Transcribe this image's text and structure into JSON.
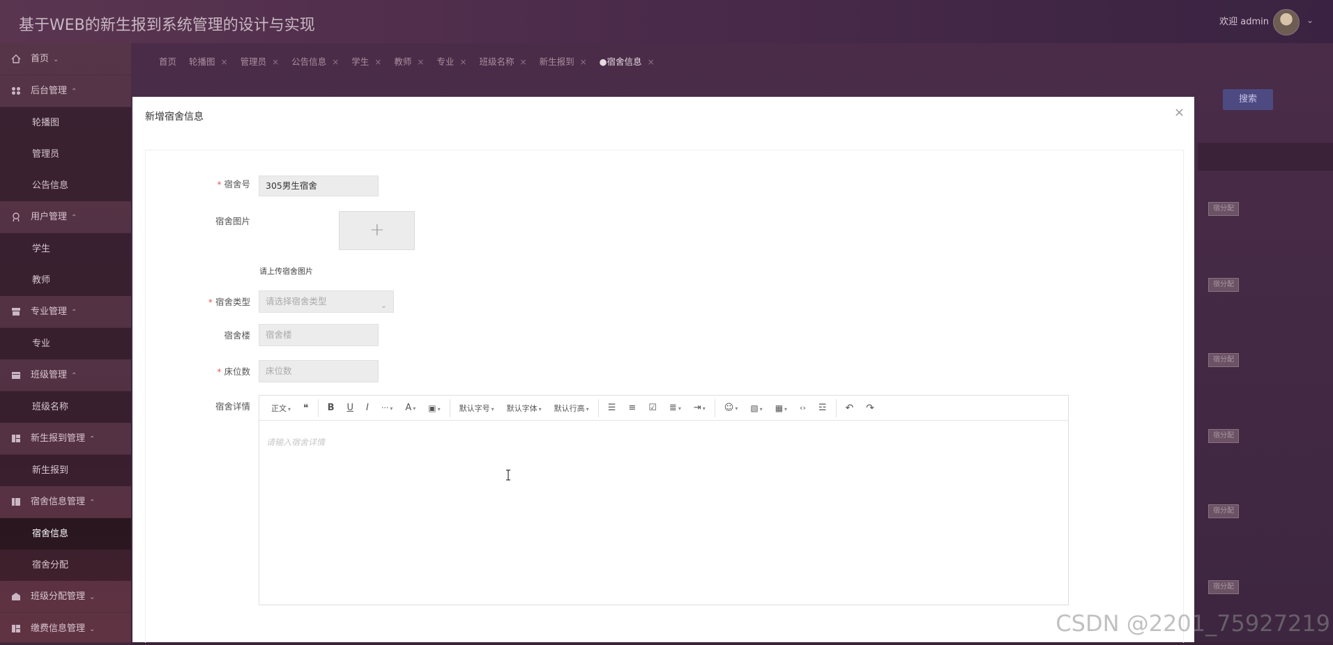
{
  "header": {
    "title": "基于WEB的新生报到系统管理的设计与实现",
    "welcome": "欢迎 admin"
  },
  "sidebar": {
    "items": [
      {
        "label": "首页",
        "type": "group",
        "icon": "home-icon"
      },
      {
        "label": "后台管理",
        "type": "group",
        "icon": "apps-icon"
      },
      {
        "label": "轮播图",
        "type": "sub"
      },
      {
        "label": "管理员",
        "type": "sub"
      },
      {
        "label": "公告信息",
        "type": "sub"
      },
      {
        "label": "用户管理",
        "type": "group",
        "icon": "user-icon"
      },
      {
        "label": "学生",
        "type": "sub"
      },
      {
        "label": "教师",
        "type": "sub"
      },
      {
        "label": "专业管理",
        "type": "group",
        "icon": "archive-icon"
      },
      {
        "label": "专业",
        "type": "sub"
      },
      {
        "label": "班级管理",
        "type": "group",
        "icon": "calendar-icon"
      },
      {
        "label": "班级名称",
        "type": "sub"
      },
      {
        "label": "新生报到管理",
        "type": "group",
        "icon": "grid-icon"
      },
      {
        "label": "新生报到",
        "type": "sub"
      },
      {
        "label": "宿舍信息管理",
        "type": "group",
        "icon": "table-icon"
      },
      {
        "label": "宿舍信息",
        "type": "sub",
        "active": true
      },
      {
        "label": "宿舍分配",
        "type": "sub"
      },
      {
        "label": "班级分配管理",
        "type": "group",
        "icon": "mail-icon"
      },
      {
        "label": "缴费信息管理",
        "type": "group",
        "icon": "grid-icon"
      }
    ]
  },
  "tabs": [
    {
      "label": "首页"
    },
    {
      "label": "轮播图"
    },
    {
      "label": "管理员"
    },
    {
      "label": "公告信息"
    },
    {
      "label": "学生"
    },
    {
      "label": "教师"
    },
    {
      "label": "专业"
    },
    {
      "label": "班级名称"
    },
    {
      "label": "新生报到"
    },
    {
      "label": "●宿舍信息",
      "current": true
    }
  ],
  "search_button": "搜索",
  "row_action": "宿分配",
  "modal": {
    "title": "新增宿舍信息",
    "fields": {
      "dorm_no": {
        "label": "宿舍号",
        "value": "305男生宿舍"
      },
      "dorm_image": {
        "label": "宿舍图片",
        "hint": "请上传宿舍图片"
      },
      "dorm_type": {
        "label": "宿舍类型",
        "placeholder": "请选择宿舍类型"
      },
      "building": {
        "label": "宿舍楼",
        "placeholder": "宿舍楼"
      },
      "beds": {
        "label": "床位数",
        "placeholder": "床位数"
      },
      "details": {
        "label": "宿舍详情",
        "placeholder": "请输入宿舍详情"
      }
    },
    "toolbar": {
      "paragraph": "正文",
      "font_size": "默认字号",
      "font_family": "默认字体",
      "line_height": "默认行高"
    }
  },
  "watermark": "CSDN @2201_75927219"
}
